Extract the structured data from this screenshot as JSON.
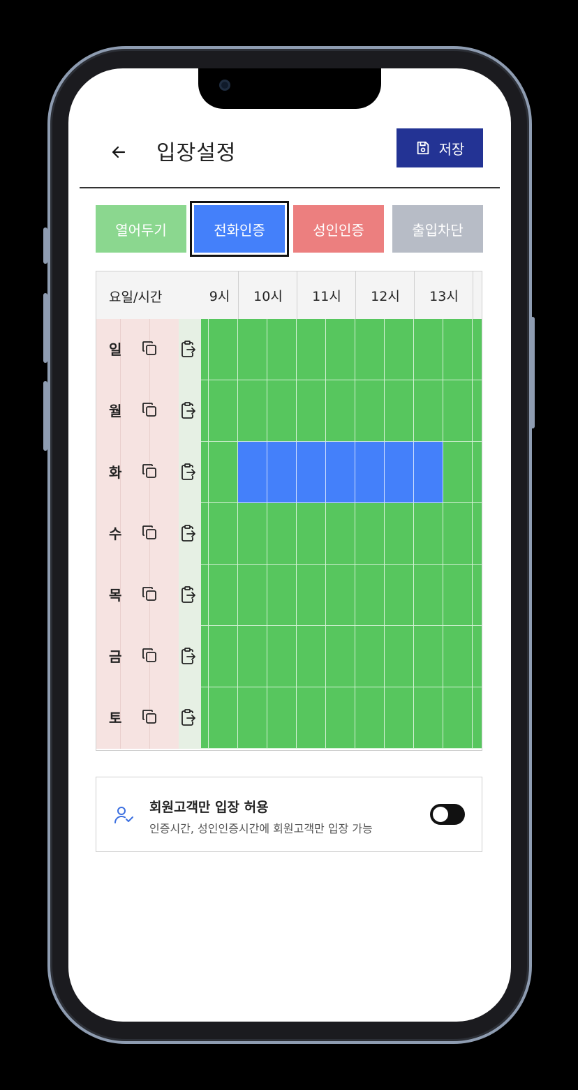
{
  "header": {
    "title": "입장설정",
    "save_label": "저장"
  },
  "modes": [
    {
      "label": "열어두기",
      "color": "#8bd78f",
      "selected": false
    },
    {
      "label": "전화인증",
      "color": "#4480fa",
      "selected": true
    },
    {
      "label": "성인인증",
      "color": "#ec7f7f",
      "selected": false
    },
    {
      "label": "출입차단",
      "color": "#b7bcc6",
      "selected": false
    }
  ],
  "schedule": {
    "corner_label": "요일/시간",
    "hours": [
      "9시",
      "10시",
      "11시",
      "12시",
      "13시"
    ],
    "days": [
      {
        "name": "일",
        "slots": [
          "open",
          "open",
          "open",
          "open",
          "open",
          "open",
          "open",
          "open",
          "open",
          "open"
        ]
      },
      {
        "name": "월",
        "slots": [
          "open",
          "open",
          "open",
          "open",
          "open",
          "open",
          "open",
          "open",
          "open",
          "open"
        ]
      },
      {
        "name": "화",
        "slots": [
          "open",
          "open",
          "phone",
          "phone",
          "phone",
          "phone",
          "phone",
          "phone",
          "phone",
          "open"
        ]
      },
      {
        "name": "수",
        "slots": [
          "open",
          "open",
          "open",
          "open",
          "open",
          "open",
          "open",
          "open",
          "open",
          "open"
        ]
      },
      {
        "name": "목",
        "slots": [
          "open",
          "open",
          "open",
          "open",
          "open",
          "open",
          "open",
          "open",
          "open",
          "open"
        ]
      },
      {
        "name": "금",
        "slots": [
          "open",
          "open",
          "open",
          "open",
          "open",
          "open",
          "open",
          "open",
          "open",
          "open"
        ]
      },
      {
        "name": "토",
        "slots": [
          "open",
          "open",
          "open",
          "open",
          "open",
          "open",
          "open",
          "open",
          "open",
          "open"
        ]
      }
    ],
    "slot_colors": {
      "open": "#57c65e",
      "phone": "#4480fa"
    }
  },
  "member_only": {
    "title": "회원고객만 입장 허용",
    "description": "인증시간, 성인인증시간에 회원고객만 입장 가능",
    "enabled": false
  }
}
